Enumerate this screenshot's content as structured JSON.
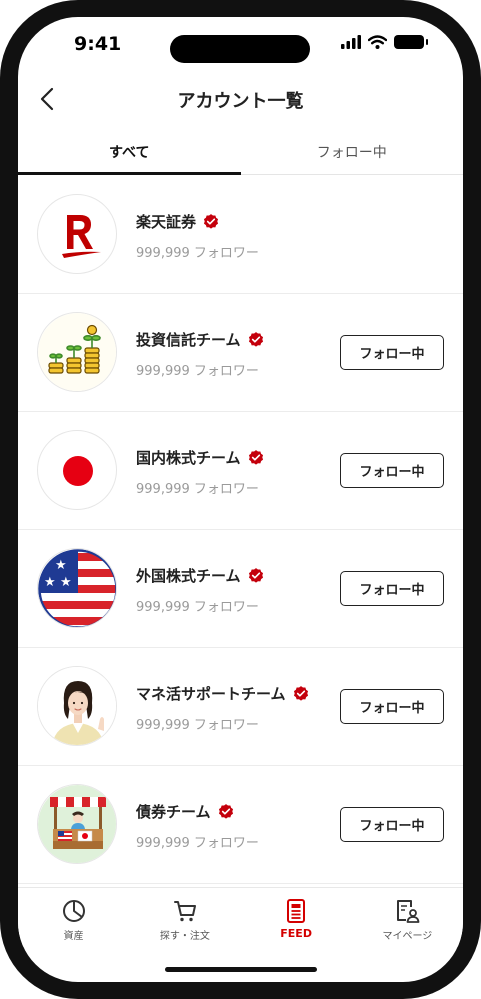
{
  "status_bar": {
    "time": "9:41"
  },
  "header": {
    "title": "アカウント一覧",
    "back_icon": "chevron-left-icon"
  },
  "tabs": [
    {
      "label": "すべて",
      "active": true
    },
    {
      "label": "フォロー中",
      "active": false
    }
  ],
  "accounts": [
    {
      "name": "楽天証券",
      "followers": "999,999 フォロワー",
      "verified": true,
      "avatar": "rakuten-logo",
      "button": ""
    },
    {
      "name": "投資信託チーム",
      "followers": "999,999 フォロワー",
      "verified": true,
      "avatar": "coins-sprout-icon",
      "button": "フォロー中"
    },
    {
      "name": "国内株式チーム",
      "followers": "999,999 フォロワー",
      "verified": true,
      "avatar": "japan-flag-icon",
      "button": "フォロー中"
    },
    {
      "name": "外国株式チーム",
      "followers": "999,999 フォロワー",
      "verified": true,
      "avatar": "us-flag-icon",
      "button": "フォロー中"
    },
    {
      "name": "マネ活サポートチーム",
      "followers": "999,999 フォロワー",
      "verified": true,
      "avatar": "support-woman-avatar",
      "button": "フォロー中"
    },
    {
      "name": "債券チーム",
      "followers": "999,999 フォロワー",
      "verified": true,
      "avatar": "market-stall-icon",
      "button": "フォロー中"
    }
  ],
  "bottom_nav": [
    {
      "label": "資産",
      "icon": "pie-chart-icon",
      "active": false
    },
    {
      "label": "探す・注文",
      "icon": "cart-icon",
      "active": false
    },
    {
      "label": "FEED",
      "icon": "feed-document-icon",
      "active": true
    },
    {
      "label": "マイページ",
      "icon": "profile-document-icon",
      "active": false
    }
  ],
  "colors": {
    "accent": "#d40000",
    "text": "#222222",
    "muted": "#9a9a9a"
  }
}
